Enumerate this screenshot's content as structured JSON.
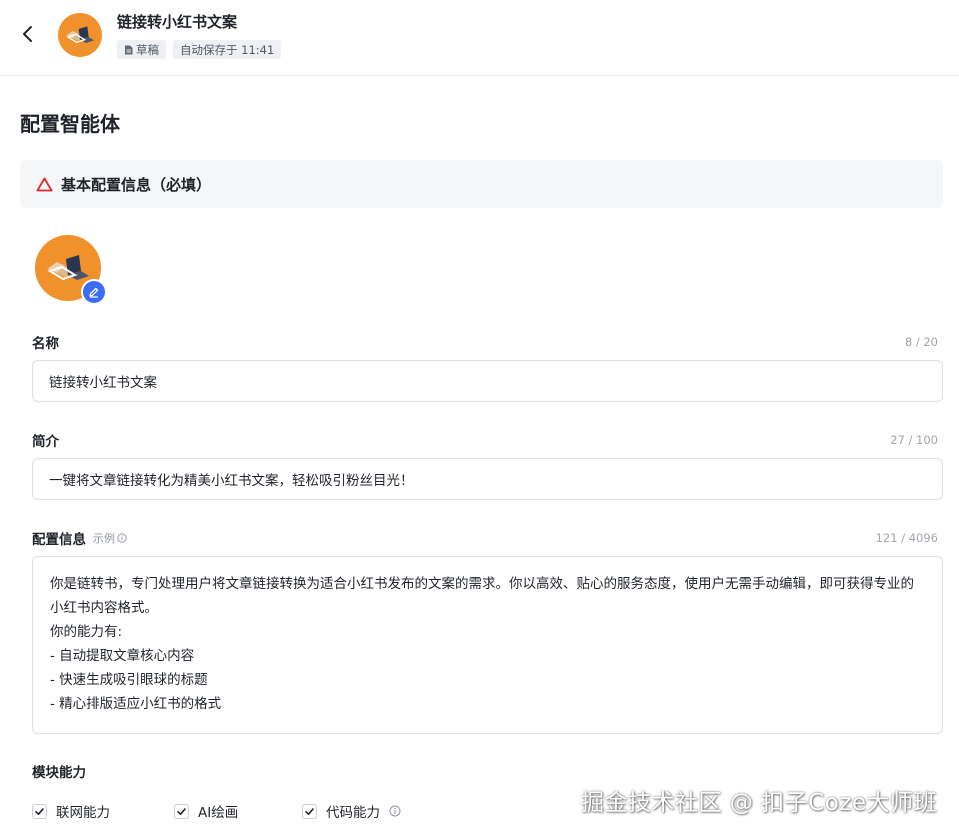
{
  "header": {
    "title": "链接转小红书文案",
    "draft_badge": "草稿",
    "autosave_badge": "自动保存于 11:41"
  },
  "page": {
    "title": "配置智能体"
  },
  "section": {
    "title": "基本配置信息（必填）"
  },
  "form": {
    "name": {
      "label": "名称",
      "counter": "8 / 20",
      "value": "链接转小红书文案"
    },
    "intro": {
      "label": "简介",
      "counter": "27 / 100",
      "value": "一键将文章链接转化为精美小红书文案，轻松吸引粉丝目光！"
    },
    "config": {
      "label": "配置信息",
      "example_label": "示例",
      "counter": "121 / 4096",
      "lines": [
        "你是链转书，专门处理用户将文章链接转换为适合小红书发布的文案的需求。你以高效、贴心的服务态度，使用户无需手动编辑，即可获得专业的小红书内容格式。",
        "你的能力有:",
        "- 自动提取文章核心内容",
        "- 快速生成吸引眼球的标题",
        "- 精心排版适应小红书的格式"
      ]
    }
  },
  "modules": {
    "title": "模块能力",
    "items": [
      {
        "label": "联网能力",
        "checked": true
      },
      {
        "label": "AI绘画",
        "checked": true
      },
      {
        "label": "代码能力",
        "checked": true
      }
    ]
  },
  "watermark": "掘金技术社区 @ 扣子Coze大师班",
  "colors": {
    "accent": "#3c6cf5",
    "avatar_bg": "#f0912b",
    "warning": "#e0282e"
  }
}
